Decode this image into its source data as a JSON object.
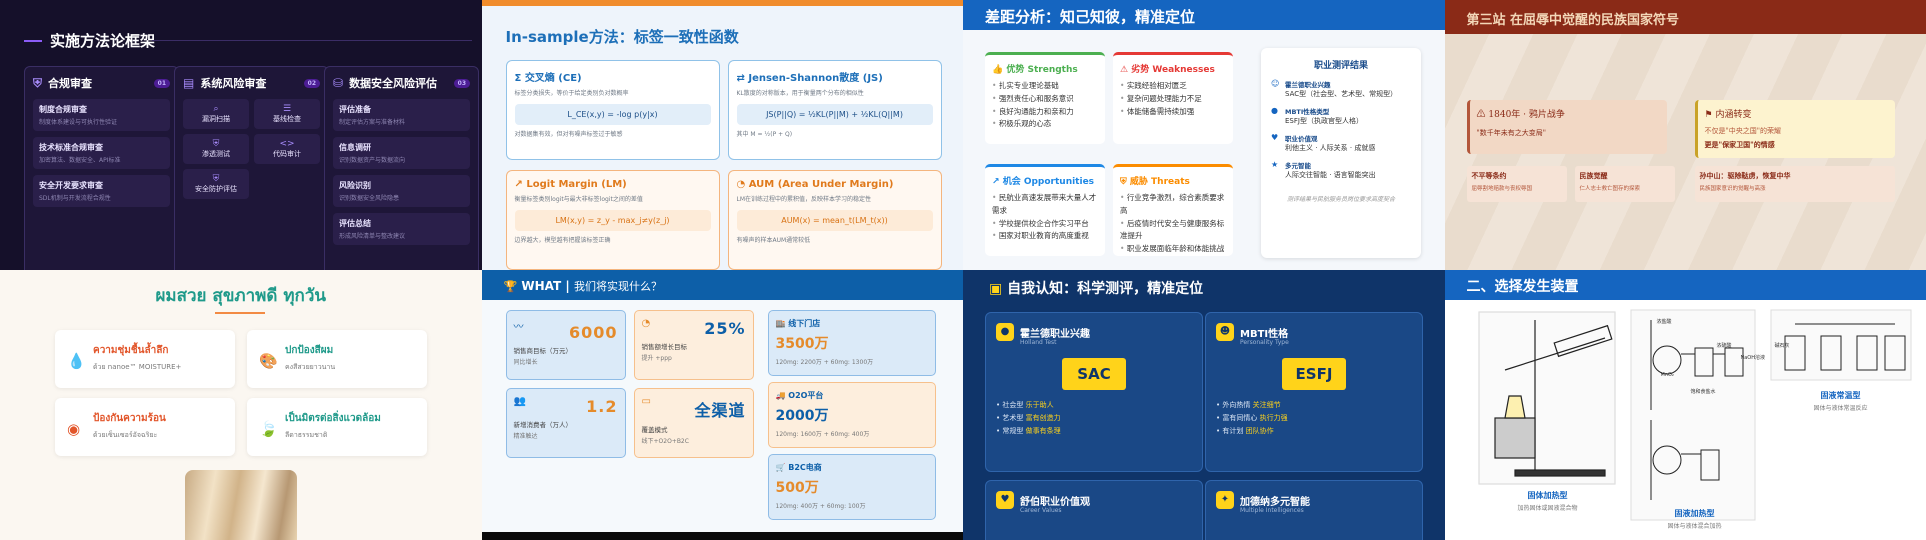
{
  "tile1": {
    "title": "实施方法论框架",
    "columns": [
      {
        "title": "合规审查",
        "num": "01",
        "items": [
          {
            "name": "制度合规审查",
            "desc": "制度体系建设与可执行性验证"
          },
          {
            "name": "技术标准合规审查",
            "desc": "加密算法、数据安全、API标准"
          },
          {
            "name": "安全开发要求审查",
            "desc": "SDL机制与开发流程合规性"
          }
        ]
      },
      {
        "title": "系统风险审查",
        "num": "02",
        "grid": [
          {
            "name": "漏洞扫描",
            "desc": "全面扫描已知漏洞"
          },
          {
            "name": "基线检查",
            "desc": "安全配置基线检查"
          },
          {
            "name": "渗透测试",
            "desc": "模拟攻击验证防护"
          },
          {
            "name": "代码审计",
            "desc": "源代码安全审计"
          },
          {
            "name": "安全防护评估",
            "desc": "防护措施有效性评估"
          }
        ]
      },
      {
        "title": "数据安全风险评估",
        "num": "03",
        "items": [
          {
            "name": "评估准备",
            "desc": "制定评估方案与准备材料"
          },
          {
            "name": "信息调研",
            "desc": "识别数据资产与数据流向"
          },
          {
            "name": "风险识别",
            "desc": "识别数据安全风险隐患"
          },
          {
            "name": "评估总结",
            "desc": "形成风险清单与整改建议"
          }
        ]
      }
    ]
  },
  "tile2": {
    "title": "In-sample方法：标签一致性函数",
    "cards": [
      {
        "title": "Σ 交叉熵 (CE)",
        "desc": "标签分类损失，等价于给定类别负对数概率",
        "formula": "L_CE(x,y) = -log p(y|x)",
        "note": "对数据集有效，但对有噪声标签过于敏感"
      },
      {
        "title": "⇄ Jensen-Shannon散度 (JS)",
        "desc": "KL散度的对称版本，用于衡量两个分布的相似性",
        "formula": "JS(P||Q) = ½KL(P||M) + ½KL(Q||M)",
        "note": "其中 M = ½(P + Q)"
      },
      {
        "title": "↗ Logit Margin (LM)",
        "desc": "衡量标签类别logit与最大非标签logit之间的差值",
        "formula": "LM(x,y) = z_y - max_j≠y(z_j)",
        "note": "边界越大，模型越有把握该标签正确"
      },
      {
        "title": "◔ AUM (Area Under Margin)",
        "desc": "LM在训练过程中的累积值，反映样本学习的稳定性",
        "formula": "AUM(x) = mean_t(LM_t(x))",
        "note": "有噪声的样本AUM通常较低"
      }
    ]
  },
  "tile3": {
    "title": "差距分析：知己知彼，精准定位",
    "quadrants": [
      {
        "title": "优势 Strengths",
        "color": "#4caf50",
        "items": [
          "扎实专业理论基础",
          "强烈责任心和服务意识",
          "良好沟通能力和亲和力",
          "积极乐观的心态"
        ]
      },
      {
        "title": "劣势 Weaknesses",
        "color": "#e53935",
        "items": [
          "实践经验相对匮乏",
          "复杂问题处理能力不足",
          "体能储备需持续加强"
        ]
      },
      {
        "title": "机会 Opportunities",
        "color": "#1e88e5",
        "items": [
          "民航业高速发展带来大量人才需求",
          "学校提供校企合作实习平台",
          "国家对职业教育的高度重视"
        ]
      },
      {
        "title": "威胁 Threats",
        "color": "#fb8c00",
        "items": [
          "行业竞争激烈，综合素质要求高",
          "后疫情时代安全与健康服务标准提升",
          "职业发展面临年龄和体能挑战"
        ]
      }
    ],
    "results": {
      "title": "职业测评结果",
      "items": [
        {
          "label": "霍兰德职业兴趣",
          "value": "SAC型（社会型、艺术型、常规型）"
        },
        {
          "label": "MBTI性格类型",
          "value": "ESFJ型（执政官型人格）"
        },
        {
          "label": "职业价值观",
          "value": "利他主义 · 人际关系 · 成就感"
        },
        {
          "label": "多元智能",
          "value": "人际交往智能 · 语言智能突出"
        }
      ],
      "footer": "测评结果与民航服务员岗位要求高度契合"
    }
  },
  "tile4": {
    "title": "第三站 在屈辱中觉醒的民族国家符号",
    "left": {
      "title": "1840年 · 鸦片战争",
      "text": "\"数千年未有之大变局\""
    },
    "right": {
      "title": "内涵转变",
      "text1": "不仅是\"中央之国\"的荣耀",
      "text2": "更是\"保家卫国\"的情感"
    },
    "small": [
      {
        "title": "不平等条约",
        "desc": "屈辱割地赔款与丧权辱国"
      },
      {
        "title": "民族觉醒",
        "desc": "仁人志士救亡图存的探索"
      },
      {
        "title": "孙中山：驱除鞑虏，恢复中华",
        "desc": "民族国家意识的觉醒与高涨"
      }
    ]
  },
  "tile5": {
    "title": "ผมสวย สุขภาพดี ทุกวัน",
    "cards": [
      {
        "title": "ความชุ่มชื้นล้ำลึก",
        "desc": "ด้วย nanoe™ MOISTURE+"
      },
      {
        "title": "ปกป้องสีผม",
        "desc": "คงสีสวยยาวนาน"
      },
      {
        "title": "ป้องกันความร้อน",
        "desc": "ด้วยเซ็นเซอร์อัจฉริยะ"
      },
      {
        "title": "เป็นมิตรต่อสิ่งแวดล้อม",
        "desc": "ลีดาธรรมชาติ"
      }
    ]
  },
  "tile6": {
    "title": "WHAT",
    "subtitle": "我们将实现什么？",
    "stats": [
      {
        "value": "6000",
        "label": "销售商目标（万元）",
        "sub": "同比增长"
      },
      {
        "value": "25%",
        "label": "销售额增长目标",
        "sub": "提升 +ppp"
      },
      {
        "value": "1.2",
        "label": "新增消费者（万人）",
        "sub": "精准触达"
      },
      {
        "value": "全渠道",
        "label": "覆盖模式",
        "sub": "线下+O2O+B2C"
      }
    ],
    "channels": [
      {
        "title": "线下门店",
        "value": "3500万",
        "sub": "120mg: 2200万 + 60mg: 1300万"
      },
      {
        "title": "O2O平台",
        "value": "2000万",
        "sub": "120mg: 1600万 + 60mg: 400万"
      },
      {
        "title": "B2C电商",
        "value": "500万",
        "sub": "120mg: 400万 + 60mg: 100万"
      }
    ]
  },
  "tile7": {
    "title": "自我认知：科学测评，精准定位",
    "panels": [
      {
        "title": "霍兰德职业兴趣",
        "en": "Holland Test",
        "code": "SAC",
        "traits": [
          [
            "社会型",
            "乐于助人"
          ],
          [
            "艺术型",
            "富有创造力"
          ],
          [
            "常规型",
            "做事有条理"
          ]
        ]
      },
      {
        "title": "MBTI性格",
        "en": "Personality Type",
        "code": "ESFJ",
        "traits": [
          [
            "外向热情",
            "关注细节"
          ],
          [
            "富有同情心",
            "执行力强"
          ],
          [
            "有计划",
            "团队协作"
          ]
        ]
      },
      {
        "title": "舒伯职业价值观",
        "en": "Career Values"
      },
      {
        "title": "加德纳多元智能",
        "en": "Multiple Intelligences"
      }
    ]
  },
  "tile8": {
    "title": "二、选择发生装置",
    "captions": [
      {
        "title": "固体加热型",
        "desc": "加热固体或固液混合物"
      },
      {
        "title": "固液加热型",
        "desc": "固体与液体混合加热"
      },
      {
        "title": "固液常温型",
        "desc": "固体与液体常温反应"
      }
    ],
    "labels": [
      "浓盐酸",
      "MnO₂",
      "浓硫酸",
      "NaOH溶液",
      "饱和食盐水",
      "碱石灰"
    ]
  }
}
